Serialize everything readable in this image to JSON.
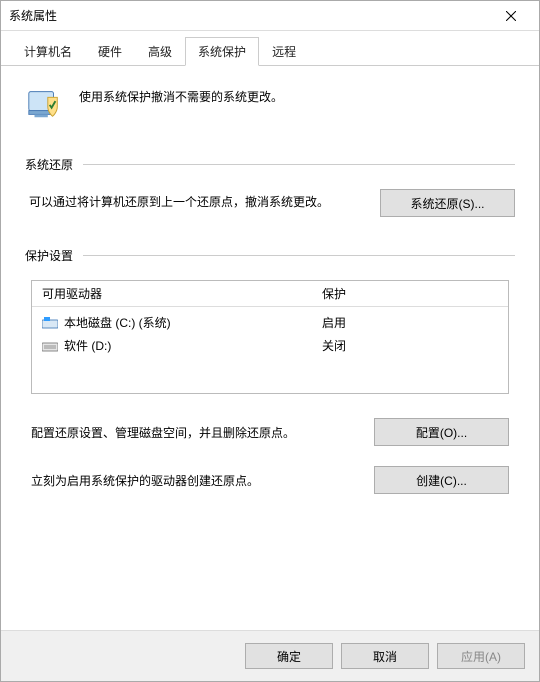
{
  "window": {
    "title": "系统属性"
  },
  "tabs": [
    {
      "label": "计算机名"
    },
    {
      "label": "硬件"
    },
    {
      "label": "高级"
    },
    {
      "label": "系统保护"
    },
    {
      "label": "远程"
    }
  ],
  "intro": "使用系统保护撤消不需要的系统更改。",
  "sections": {
    "restore": {
      "title": "系统还原",
      "desc": "可以通过将计算机还原到上一个还原点，撤消系统更改。",
      "button": "系统还原(S)..."
    },
    "protect": {
      "title": "保护设置",
      "columns": {
        "drive": "可用驱动器",
        "protection": "保护"
      },
      "rows": [
        {
          "name": "本地磁盘 (C:) (系统)",
          "protection": "启用",
          "icon": "c"
        },
        {
          "name": "软件 (D:)",
          "protection": "关闭",
          "icon": "d"
        }
      ],
      "configure": {
        "desc": "配置还原设置、管理磁盘空间，并且删除还原点。",
        "button": "配置(O)..."
      },
      "create": {
        "desc": "立刻为启用系统保护的驱动器创建还原点。",
        "button": "创建(C)..."
      }
    }
  },
  "footer": {
    "ok": "确定",
    "cancel": "取消",
    "apply": "应用(A)"
  }
}
